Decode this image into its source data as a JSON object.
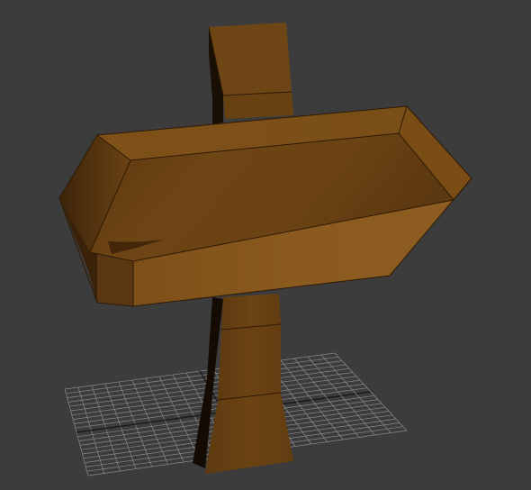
{
  "viewport": {
    "background": "#3c3c3c",
    "grid_color": "#8a8a8a",
    "grid_dark_color": "#1a1a1a"
  },
  "scene": {
    "object": "wooden-signpost",
    "colors": {
      "wood_front": "#6b4212",
      "wood_light": "#8a5a1e",
      "wood_top": "#7a4d17",
      "wood_dark": "#4a2c0a",
      "wood_shadow": "#2a1806",
      "edge_line": "#2e1a06",
      "highlight": "#a06a28"
    },
    "post_segments": 4,
    "grid_divisions": 10
  }
}
